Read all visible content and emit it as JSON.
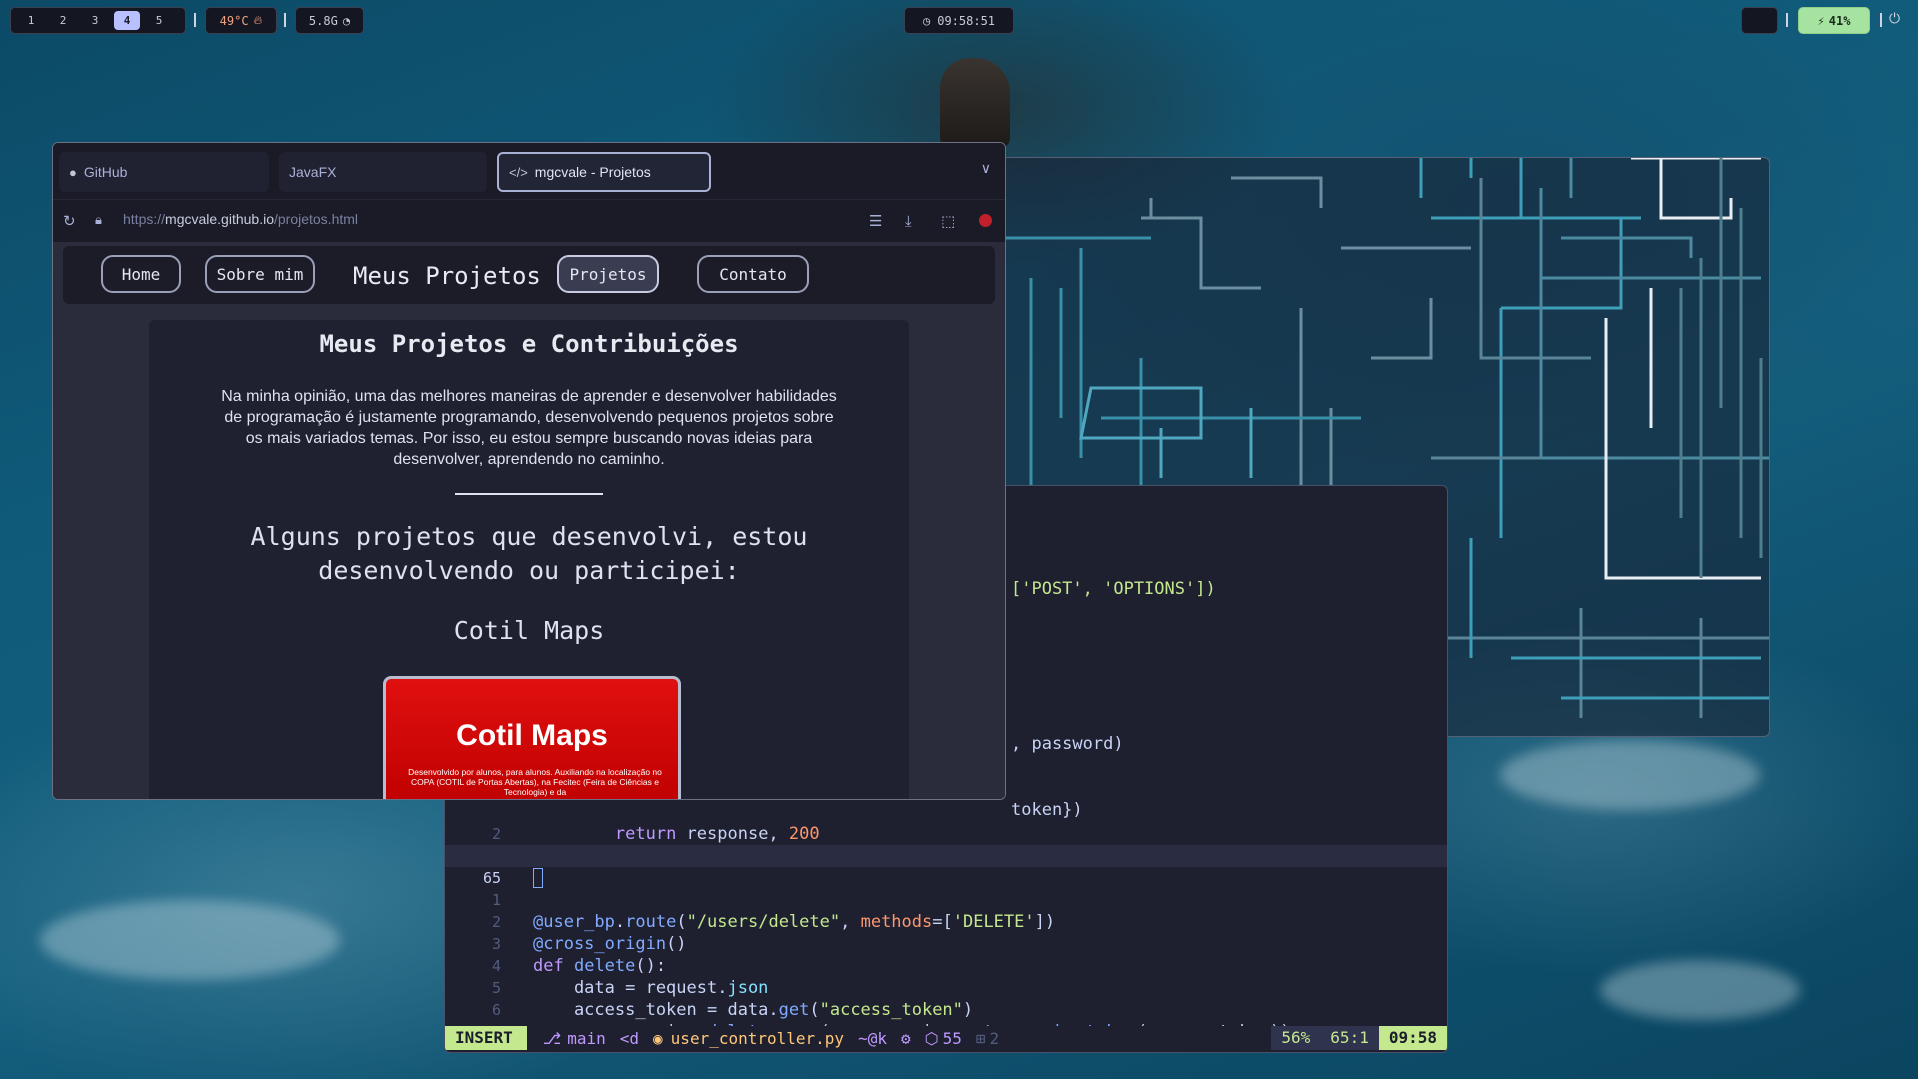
{
  "topbar": {
    "workspaces": [
      "1",
      "2",
      "3",
      "4",
      "5"
    ],
    "active_workspace": "4",
    "cpu_temp": "49°C",
    "memory": "5.8G",
    "clock": "09:58:51",
    "battery": "41%"
  },
  "browser": {
    "tabs": [
      {
        "label": "GitHub",
        "icon": "github-icon"
      },
      {
        "label": "JavaFX",
        "icon": ""
      },
      {
        "label": "mgcvale - Projetos",
        "icon": "code-icon"
      }
    ],
    "url_prefix": "https://",
    "url_host": "mgcvale.github.io",
    "url_path": "/projetos.html"
  },
  "site": {
    "nav": {
      "home": "Home",
      "about": "Sobre mim",
      "title": "Meus Projetos",
      "projects": "Projetos",
      "contact": "Contato"
    },
    "heading": "Meus Projetos e Contribuições",
    "intro": "Na minha opinião, uma das melhores maneiras de aprender e desenvolver habilidades de programação é justamente programando, desenvolvendo pequenos projetos sobre os mais variados temas. Por isso, eu estou sempre buscando novas ideias para desenvolver, aprendendo no caminho.",
    "subheading": "Alguns projetos que desenvolvi, estou desenvolvendo ou participei:",
    "project_name": "Cotil Maps",
    "thumb_logo": "Cotil Maps",
    "thumb_tagline": "Desenvolvido por alunos, para alunos. Auxiliando na localização no COPA (COTIL de Portas Abertas), na Fecitec (Feira de Ciências e Tecnologia) e da"
  },
  "editor": {
    "fragments": {
      "methods_tail": "['POST', 'OPTIONS'])",
      "password_tail": ", password)",
      "token_tail": "token})"
    },
    "status": {
      "mode": "INSERT",
      "branch": "main",
      "keys": "<d",
      "file": "user_controller.py",
      "cmd": "~@k",
      "count": "55",
      "changes": "2",
      "percent": "56%",
      "position": "65:1",
      "time": "09:58"
    }
  }
}
